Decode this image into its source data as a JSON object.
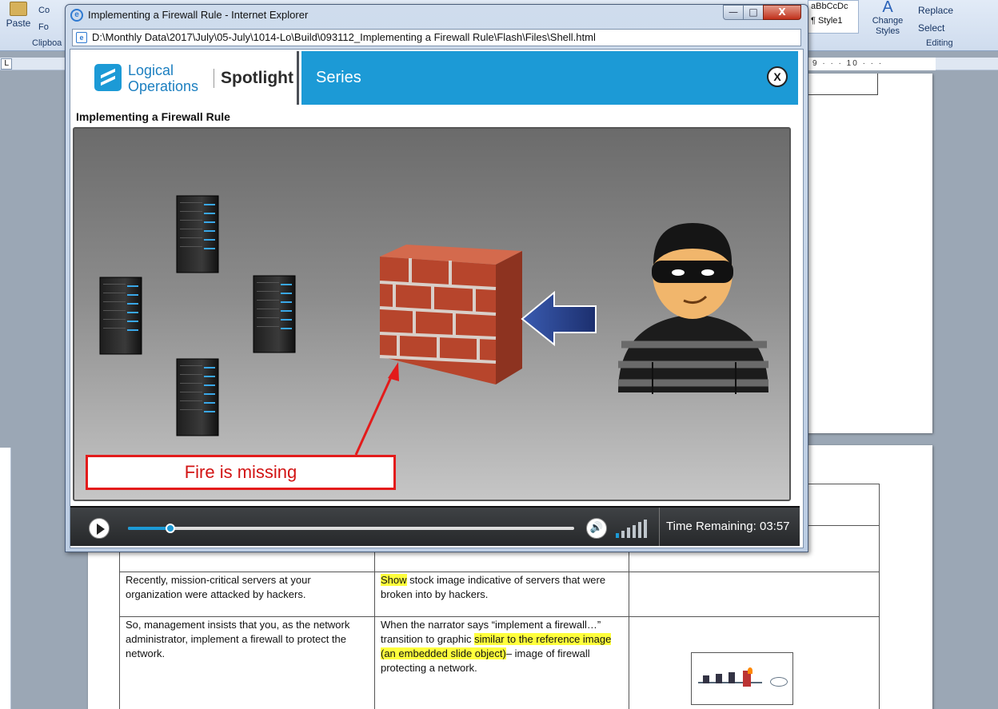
{
  "word": {
    "ribbon": {
      "paste_label": "Paste",
      "copy_partial": "Co",
      "format_painter_partial": "Fo",
      "clipboard_group_partial": "Clipboa",
      "styles_gallery_sample": "aBbCcDc",
      "styles_gallery_style": "¶ Style1",
      "change_styles_label": "Change Styles",
      "replace_label": "Replace",
      "select_label": "Select",
      "editing_group": "Editing"
    },
    "ruler": {
      "marks": "9 · · · 10 · · ·"
    },
    "table": {
      "rows": [
        {
          "narration": "Recently, mission-critical servers at your organization were attacked by hackers.",
          "direction_hl": "Show",
          "direction_rest": " stock image indicative of servers that were broken into by hackers."
        },
        {
          "narration": "So, management insists that you, as the network administrator, implement a firewall to protect the network.",
          "direction_pre": "When the narrator says “implement a firewall…” transition to graphic ",
          "direction_hl": "similar to the reference image (an embedded slide object)",
          "direction_post": "– image of firewall protecting a network."
        }
      ]
    }
  },
  "ie": {
    "title": "Implementing a Firewall Rule - Internet Explorer",
    "address": "D:\\Monthly Data\\2017\\July\\05-July\\1014-Lo\\Build\\093112_Implementing a Firewall Rule\\Flash\\Files\\Shell.html",
    "min_glyph": "—",
    "max_glyph": "□",
    "close_glyph": "X"
  },
  "player": {
    "brand_line1": "Logical",
    "brand_line2": "Operations",
    "brand_product": "Spotlight",
    "series_label": "Series",
    "close_label": "X",
    "lesson_title": "Implementing a Firewall Rule",
    "callout_text": "Fire is missing",
    "progress_fraction": 0.095,
    "volume_level": 1,
    "time_remaining": "Time Remaining: 03:57"
  },
  "icons": [
    "play-icon",
    "volume-icon",
    "server-icon",
    "firewall-icon",
    "arrow-icon",
    "hacker-icon"
  ],
  "colors": {
    "accent": "#1c9ad6",
    "callout": "#e31b1b",
    "highlight": "#ffff3c"
  }
}
